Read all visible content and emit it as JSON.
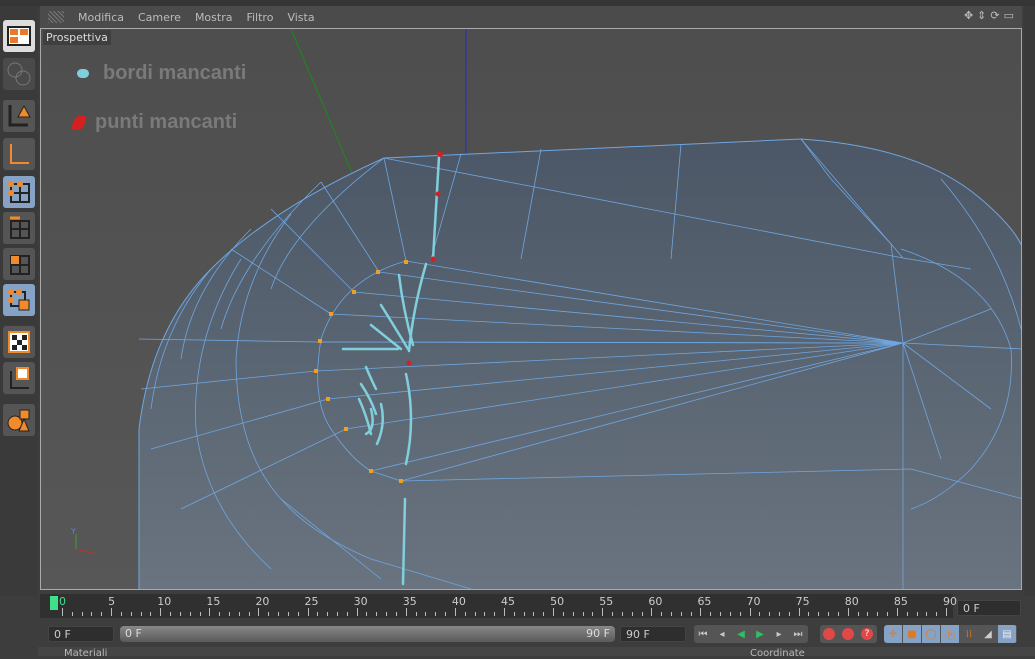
{
  "menu": {
    "items": [
      "Modifica",
      "Camere",
      "Mostra",
      "Filtro",
      "Vista"
    ]
  },
  "viewport": {
    "label": "Prospettiva",
    "legend": [
      {
        "label": "bordi mancanti",
        "color": "#7fd0dc"
      },
      {
        "label": "punti mancanti",
        "color": "#d42020"
      }
    ]
  },
  "nav_icons": [
    "move-view-icon",
    "zoom-view-icon",
    "rotate-view-icon",
    "maximize-view-icon"
  ],
  "left_toolbar": [
    "layout-icon",
    "model-mode-icon",
    "object-mode-icon",
    "axis-mode-icon",
    "points-mode-icon",
    "edges-mode-icon",
    "polygons-mode-icon",
    "uv-points-mode-icon",
    "texture-mode-icon",
    "texture-axis-mode-icon",
    "primitives-icon"
  ],
  "timeline": {
    "ticks": [
      "0",
      "5",
      "10",
      "15",
      "20",
      "25",
      "30",
      "35",
      "40",
      "45",
      "50",
      "55",
      "60",
      "65",
      "70",
      "75",
      "80",
      "85",
      "90"
    ],
    "current_frame": "0 F",
    "playhead_color": "#3fe08a"
  },
  "transport": {
    "start_field": "0 F",
    "range_start": "0 F",
    "range_end": "90 F",
    "end_field": "90 F"
  },
  "panels": {
    "materials": "Materiali",
    "coordinates": "Coordinate"
  },
  "colors": {
    "mesh_edge": "#6fa6e0",
    "point": "#f0a020",
    "missing_edge": "#7fd0dc",
    "missing_point": "#d42020"
  }
}
